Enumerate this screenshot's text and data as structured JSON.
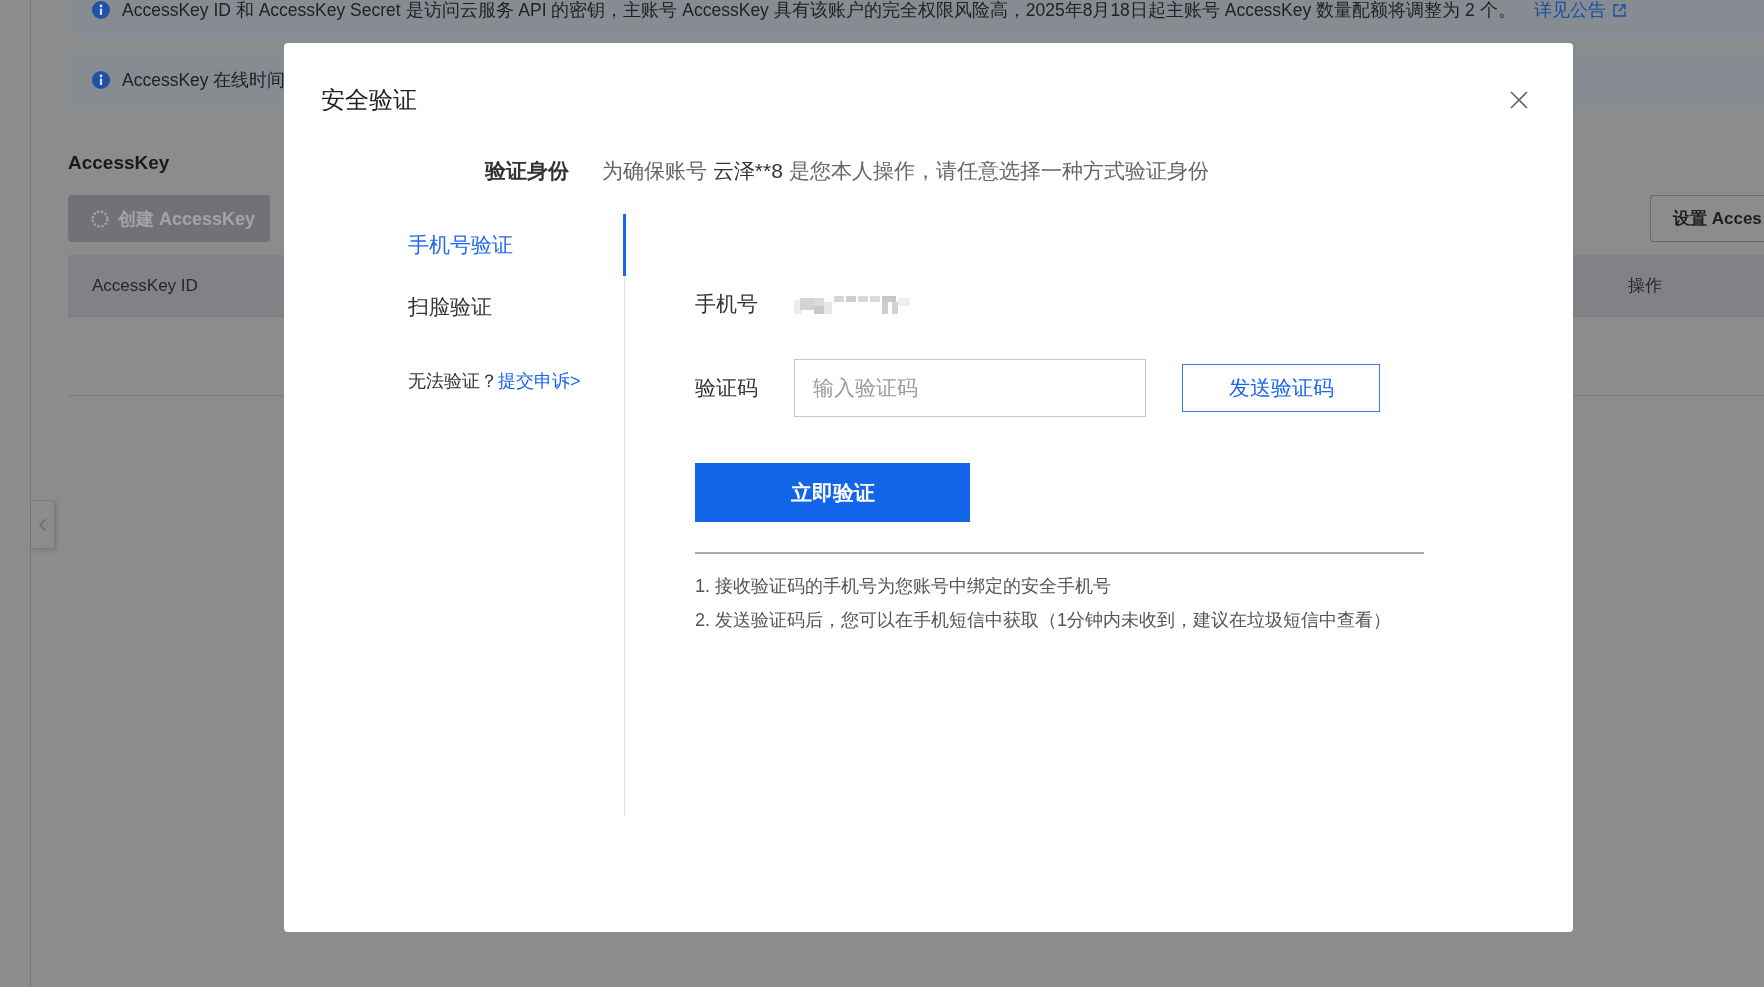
{
  "background": {
    "notices": [
      {
        "text": "AccessKey ID 和 AccessKey Secret 是访问云服务 API 的密钥，主账号 AccessKey 具有该账户的完全权限风险高，2025年8月18日起主账号 AccessKey 数量配额将调整为 2 个。",
        "link": "详见公告"
      },
      {
        "text": "AccessKey 在线时间"
      }
    ],
    "heading": "AccessKey",
    "create_button": {
      "label": "创建 AccessKey",
      "disabled": true,
      "loading": true
    },
    "settings_button": {
      "label": "设置 Acces"
    },
    "table": {
      "columns": [
        "AccessKey ID",
        "操作"
      ]
    }
  },
  "dialog": {
    "title": "安全验证",
    "identity": {
      "label": "验证身份",
      "prompt_before": "为确保账号",
      "account": "云泽**8",
      "prompt_after": "是您本人操作，请任意选择一种方式验证身份"
    },
    "methods": [
      {
        "label": "手机号验证",
        "selected": true
      },
      {
        "label": "扫脸验证",
        "selected": false
      }
    ],
    "help": {
      "text": "无法验证？",
      "link": "提交申诉>"
    },
    "form": {
      "phone_label": "手机号",
      "code_label": "验证码",
      "code_field": {
        "placeholder": "输入验证码"
      },
      "send_button": "发送验证码",
      "submit_button": "立即验证"
    },
    "notes": [
      "1. 接收验证码的手机号为您账号中绑定的安全手机号",
      "2. 发送验证码后，您可以在手机短信中获取（1分钟内未收到，建议在垃圾短信中查看）"
    ]
  }
}
